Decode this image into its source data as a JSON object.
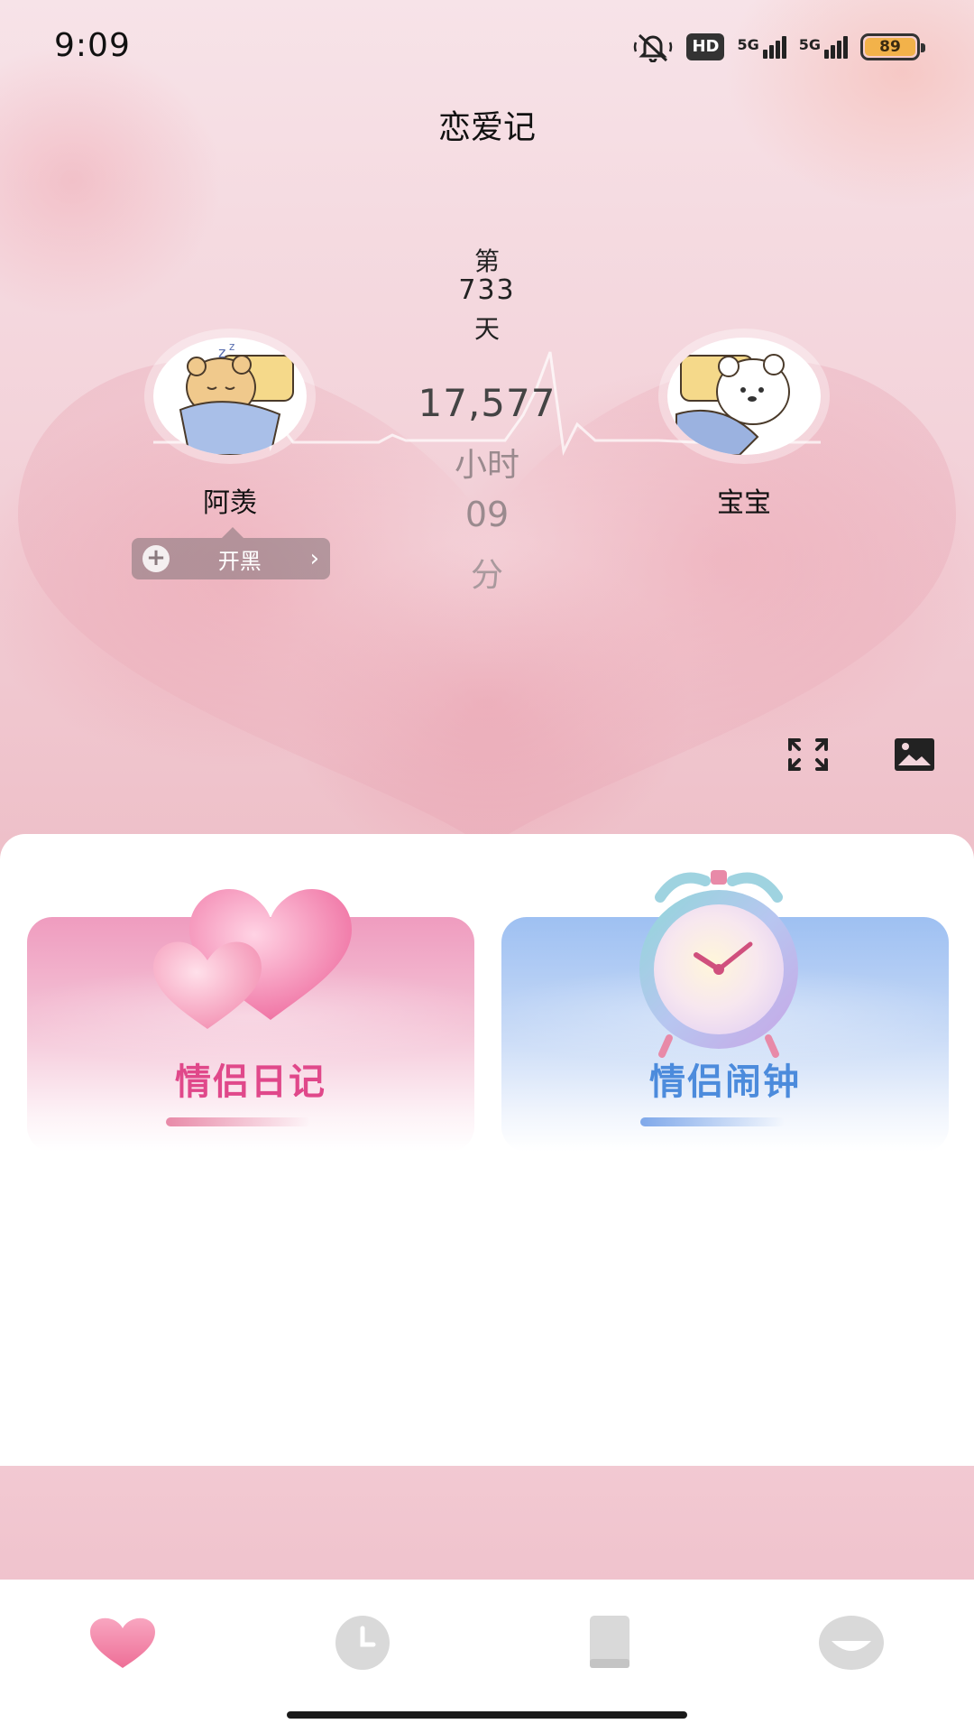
{
  "status_bar": {
    "time": "9:09",
    "hd_label": "HD",
    "network_1": "5G",
    "network_2": "5G",
    "battery": "89",
    "battery_color": "#f2b24a"
  },
  "header": {
    "title": "恋爱记"
  },
  "counter": {
    "day_prefix": "第",
    "days": "733",
    "day_suffix": "天",
    "hours": "17,577",
    "hours_unit": "小时",
    "minutes": "09",
    "minutes_unit": "分"
  },
  "couple": {
    "left_name": "阿羡",
    "right_name": "宝宝",
    "left_avatar_icon": "sleeping-bear-icon",
    "right_avatar_icon": "bear-blanket-icon"
  },
  "game_pill": {
    "icon": "plus-icon",
    "label": "开黑",
    "chevron": "›"
  },
  "hero_actions": {
    "fullscreen_icon": "fullscreen-icon",
    "wallpaper_icon": "image-icon"
  },
  "cards": [
    {
      "title": "情侣日记",
      "icon": "hearts-icon",
      "accent": "#e0488a"
    },
    {
      "title": "情侣闹钟",
      "icon": "alarm-clock-icon",
      "accent": "#4c8bdc"
    }
  ],
  "tabs": [
    {
      "icon": "heart-icon",
      "active": true,
      "color": "#f07a9c"
    },
    {
      "icon": "clock-icon",
      "active": false,
      "color": "#d6d6d6"
    },
    {
      "icon": "book-icon",
      "active": false,
      "color": "#d6d6d6"
    },
    {
      "icon": "face-icon",
      "active": false,
      "color": "#d6d6d6"
    }
  ]
}
